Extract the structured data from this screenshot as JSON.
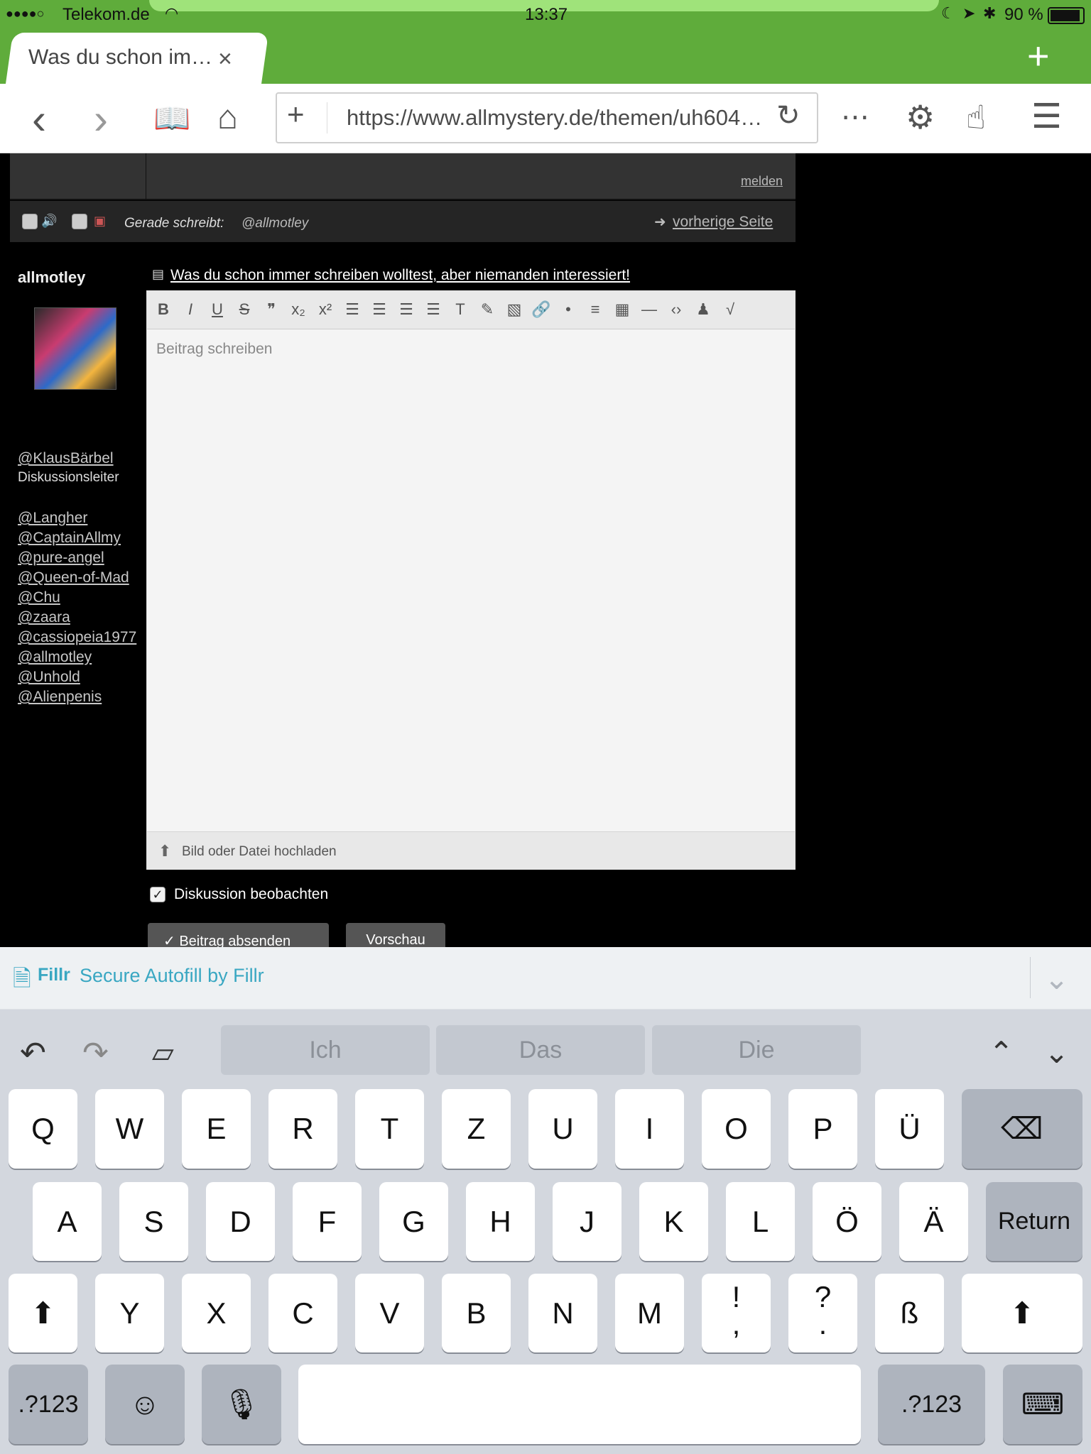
{
  "status": {
    "carrier": "Telekom.de",
    "time": "13:37",
    "battery": "90 %"
  },
  "browser": {
    "tab_title": "Was du schon im…",
    "url": "https://www.allmystery.de/themen/uh604…"
  },
  "forum": {
    "report_link": "melden",
    "typing_label": "Gerade schreibt:",
    "typing_user": "@allmotley",
    "prev_page": "vorherige Seite",
    "username": "allmotley",
    "thread_title": "Was du schon immer schreiben wolltest, aber niemanden interessiert!",
    "leader_link": "@KlausBärbel",
    "leader_role": "Diskussionsleiter",
    "mentions": [
      "@Langher",
      "@CaptainAllmy",
      "@pure-angel",
      "@Queen-of-Mad",
      "@Chu",
      "@zaara",
      "@cassiopeia1977",
      "@allmotley",
      "@Unhold",
      "@Alienpenis"
    ]
  },
  "editor": {
    "placeholder": "Beitrag schreiben",
    "upload_label": "Bild oder Datei hochladen",
    "watch_label": "Diskussion beobachten",
    "submit_label": "Beitrag absenden",
    "preview_label": "Vorschau"
  },
  "fillr": {
    "brand": "Fillr",
    "label": "Secure Autofill by Fillr"
  },
  "keyboard": {
    "suggestions": [
      "Ich",
      "Das",
      "Die"
    ],
    "row1": [
      "Q",
      "W",
      "E",
      "R",
      "T",
      "Z",
      "U",
      "I",
      "O",
      "P",
      "Ü"
    ],
    "row2": [
      "A",
      "S",
      "D",
      "F",
      "G",
      "H",
      "J",
      "K",
      "L",
      "Ö",
      "Ä"
    ],
    "return": "Return",
    "row3": [
      "Y",
      "X",
      "C",
      "V",
      "B",
      "N",
      "M"
    ],
    "punct1_top": "!",
    "punct1_bottom": ",",
    "punct2_top": "?",
    "punct2_bottom": ".",
    "sharp_s": "ß",
    "numbers": ".?123"
  },
  "colors": {
    "green": "#5fac3b",
    "fillr": "#39a7c2",
    "keyboard": "#d3d7de"
  }
}
